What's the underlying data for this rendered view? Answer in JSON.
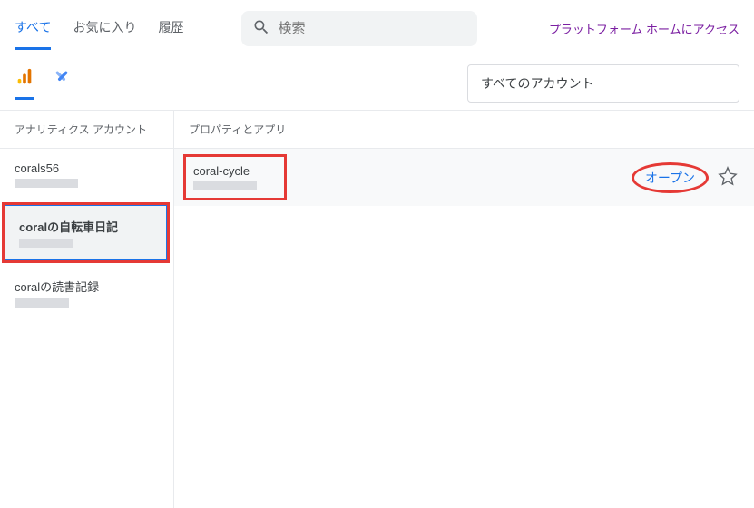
{
  "tabs": {
    "all": "すべて",
    "favorites": "お気に入り",
    "history": "履歴"
  },
  "search": {
    "placeholder": "検索"
  },
  "platform_link": "プラットフォーム ホームにアクセス",
  "account_filter": {
    "value": "すべてのアカウント"
  },
  "columns": {
    "accounts_header": "アナリティクス アカウント",
    "properties_header": "プロパティとアプリ"
  },
  "accounts": [
    {
      "name": "corals56"
    },
    {
      "name": "coralの自転車日記"
    },
    {
      "name": "coralの読書記録"
    }
  ],
  "properties": [
    {
      "name": "coral-cycle",
      "open_label": "オープン"
    }
  ]
}
